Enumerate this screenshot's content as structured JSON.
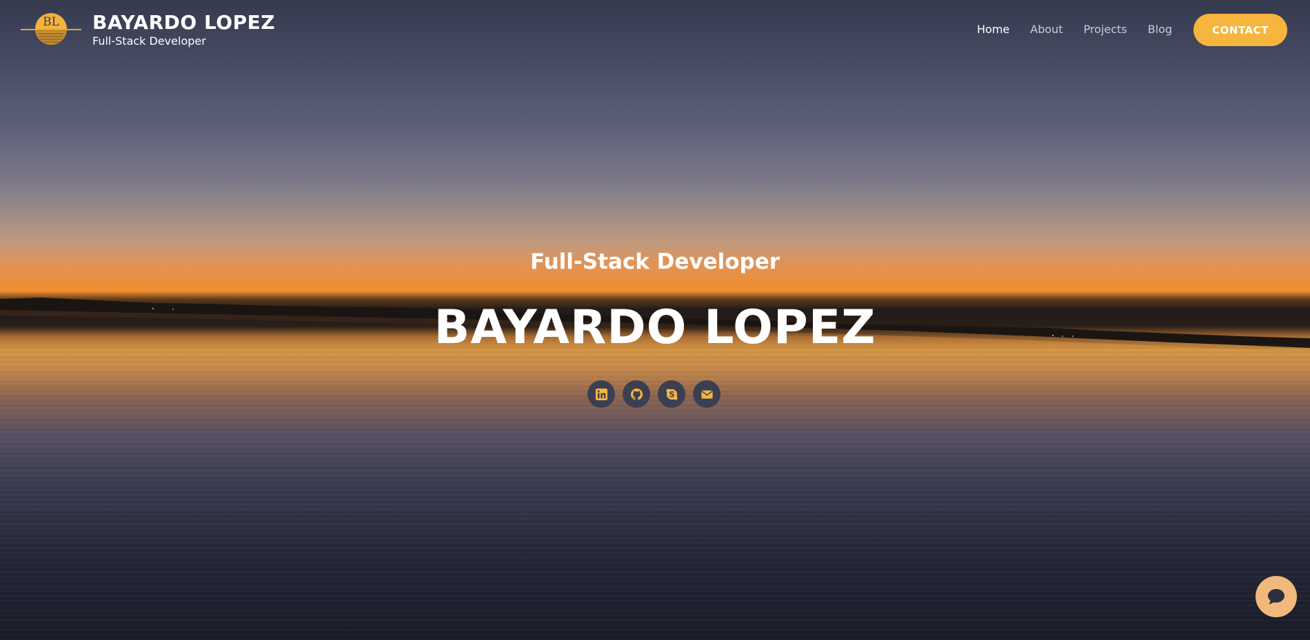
{
  "header": {
    "logo_text": "BL",
    "brand_name": "BAYARDO LOPEZ",
    "brand_tagline": "Full-Stack Developer",
    "nav": [
      {
        "label": "Home",
        "active": true
      },
      {
        "label": "About",
        "active": false
      },
      {
        "label": "Projects",
        "active": false
      },
      {
        "label": "Blog",
        "active": false
      }
    ],
    "contact_label": "CONTACT"
  },
  "hero": {
    "subtitle": "Full-Stack Developer",
    "title": "BAYARDO LOPEZ",
    "socials": [
      {
        "icon": "linkedin-icon"
      },
      {
        "icon": "github-icon"
      },
      {
        "icon": "skype-icon"
      },
      {
        "icon": "envelope-icon"
      }
    ]
  },
  "chat": {
    "icon": "chat-bubble-icon"
  },
  "colors": {
    "accent": "#f6b53d",
    "social_bg": "#3c3f52",
    "chat_bg": "#f1b97c"
  }
}
